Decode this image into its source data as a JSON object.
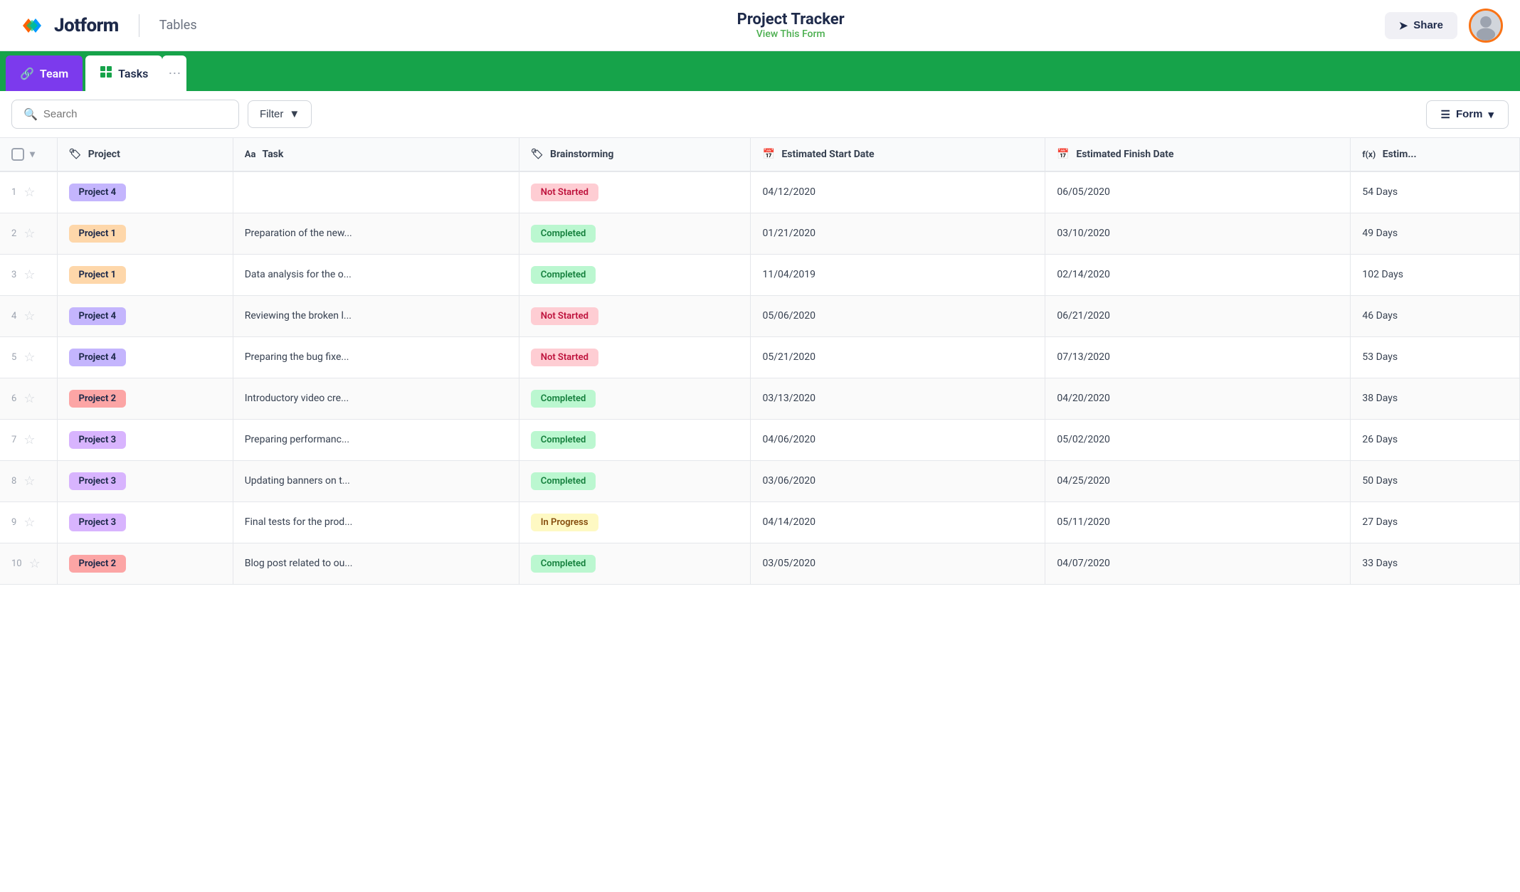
{
  "header": {
    "logo_text": "Jotform",
    "tables_label": "Tables",
    "project_title": "Project Tracker",
    "view_form_link": "View This Form",
    "share_label": "Share"
  },
  "tabs": [
    {
      "id": "team",
      "label": "Team",
      "active": false,
      "type": "team"
    },
    {
      "id": "tasks",
      "label": "Tasks",
      "active": true,
      "type": "tasks"
    }
  ],
  "toolbar": {
    "search_placeholder": "Search",
    "filter_label": "Filter",
    "form_label": "Form"
  },
  "columns": [
    {
      "id": "checkbox",
      "label": ""
    },
    {
      "id": "project",
      "label": "Project",
      "icon": "tag"
    },
    {
      "id": "task",
      "label": "Task",
      "icon": "aa"
    },
    {
      "id": "brainstorming",
      "label": "Brainstorming",
      "icon": "tag"
    },
    {
      "id": "start_date",
      "label": "Estimated Start Date",
      "icon": "calendar"
    },
    {
      "id": "finish_date",
      "label": "Estimated Finish Date",
      "icon": "calendar"
    },
    {
      "id": "estimate",
      "label": "Estim...",
      "icon": "fx"
    }
  ],
  "rows": [
    {
      "num": 1,
      "project": "Project 4",
      "project_class": "badge-project4",
      "task": "",
      "brainstorming": "Not Started",
      "brainstorming_class": "status-not-started",
      "start_date": "04/12/2020",
      "finish_date": "06/05/2020",
      "estimate": "54 Days"
    },
    {
      "num": 2,
      "project": "Project 1",
      "project_class": "badge-project1",
      "task": "Preparation of the new...",
      "brainstorming": "Completed",
      "brainstorming_class": "status-completed",
      "start_date": "01/21/2020",
      "finish_date": "03/10/2020",
      "estimate": "49 Days"
    },
    {
      "num": 3,
      "project": "Project 1",
      "project_class": "badge-project1",
      "task": "Data analysis for the o...",
      "brainstorming": "Completed",
      "brainstorming_class": "status-completed",
      "start_date": "11/04/2019",
      "finish_date": "02/14/2020",
      "estimate": "102 Days"
    },
    {
      "num": 4,
      "project": "Project 4",
      "project_class": "badge-project4",
      "task": "Reviewing the broken l...",
      "brainstorming": "Not Started",
      "brainstorming_class": "status-not-started",
      "start_date": "05/06/2020",
      "finish_date": "06/21/2020",
      "estimate": "46 Days"
    },
    {
      "num": 5,
      "project": "Project 4",
      "project_class": "badge-project4",
      "task": "Preparing the bug fixe...",
      "brainstorming": "Not Started",
      "brainstorming_class": "status-not-started",
      "start_date": "05/21/2020",
      "finish_date": "07/13/2020",
      "estimate": "53 Days"
    },
    {
      "num": 6,
      "project": "Project 2",
      "project_class": "badge-project2",
      "task": "Introductory video cre...",
      "brainstorming": "Completed",
      "brainstorming_class": "status-completed",
      "start_date": "03/13/2020",
      "finish_date": "04/20/2020",
      "estimate": "38 Days"
    },
    {
      "num": 7,
      "project": "Project 3",
      "project_class": "badge-project3",
      "task": "Preparing performanc...",
      "brainstorming": "Completed",
      "brainstorming_class": "status-completed",
      "start_date": "04/06/2020",
      "finish_date": "05/02/2020",
      "estimate": "26 Days"
    },
    {
      "num": 8,
      "project": "Project 3",
      "project_class": "badge-project3",
      "task": "Updating banners on t...",
      "brainstorming": "Completed",
      "brainstorming_class": "status-completed",
      "start_date": "03/06/2020",
      "finish_date": "04/25/2020",
      "estimate": "50 Days"
    },
    {
      "num": 9,
      "project": "Project 3",
      "project_class": "badge-project3",
      "task": "Final tests for the prod...",
      "brainstorming": "In Progress",
      "brainstorming_class": "status-in-progress",
      "start_date": "04/14/2020",
      "finish_date": "05/11/2020",
      "estimate": "27 Days"
    },
    {
      "num": 10,
      "project": "Project 2",
      "project_class": "badge-project2",
      "task": "Blog post related to ou...",
      "brainstorming": "Completed",
      "brainstorming_class": "status-completed",
      "start_date": "03/05/2020",
      "finish_date": "04/07/2020",
      "estimate": "33 Days"
    }
  ]
}
